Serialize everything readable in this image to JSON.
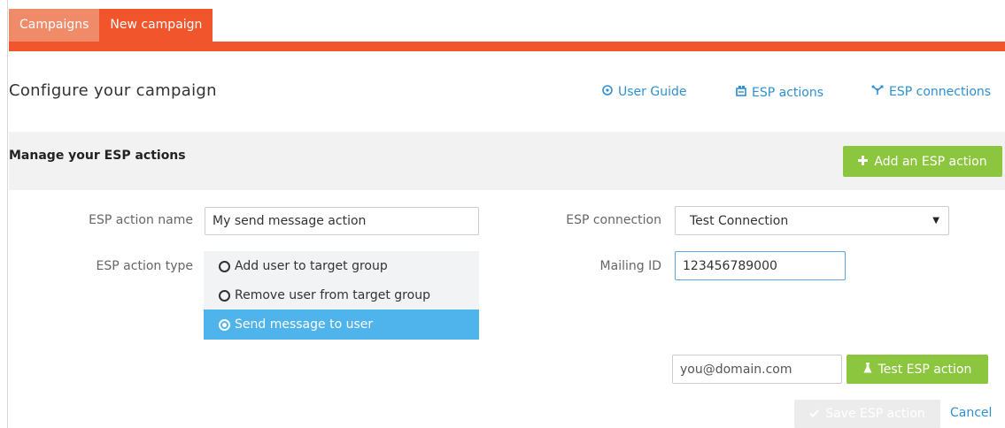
{
  "tabs": [
    {
      "label": "Campaigns",
      "active": false
    },
    {
      "label": "New campaign",
      "active": true
    }
  ],
  "header": {
    "title": "Configure your campaign",
    "links": [
      {
        "label": "User Guide",
        "icon": "help-circle-icon"
      },
      {
        "label": "ESP actions",
        "icon": "esp-actions-icon"
      },
      {
        "label": "ESP connections",
        "icon": "connections-icon"
      }
    ]
  },
  "manage": {
    "title": "Manage your ESP actions",
    "add_button": "Add an ESP action"
  },
  "form": {
    "name_label": "ESP action name",
    "name_value": "My send message action",
    "type_label": "ESP action type",
    "type_options": [
      {
        "label": "Add user to target group",
        "selected": false
      },
      {
        "label": "Remove user from target group",
        "selected": false
      },
      {
        "label": "Send message to user",
        "selected": true
      }
    ],
    "connection_label": "ESP connection",
    "connection_value": "Test Connection",
    "mailing_label": "Mailing ID",
    "mailing_value": "123456789000",
    "email_placeholder": "you@domain.com",
    "test_button": "Test ESP action",
    "save_button": "Save ESP action",
    "cancel": "Cancel"
  },
  "colors": {
    "brand_orange": "#f0552b",
    "inactive_tab": "#f08b6a",
    "green": "#8cc63f",
    "link_blue": "#2e90d1",
    "selected_blue": "#4fb3ec"
  }
}
